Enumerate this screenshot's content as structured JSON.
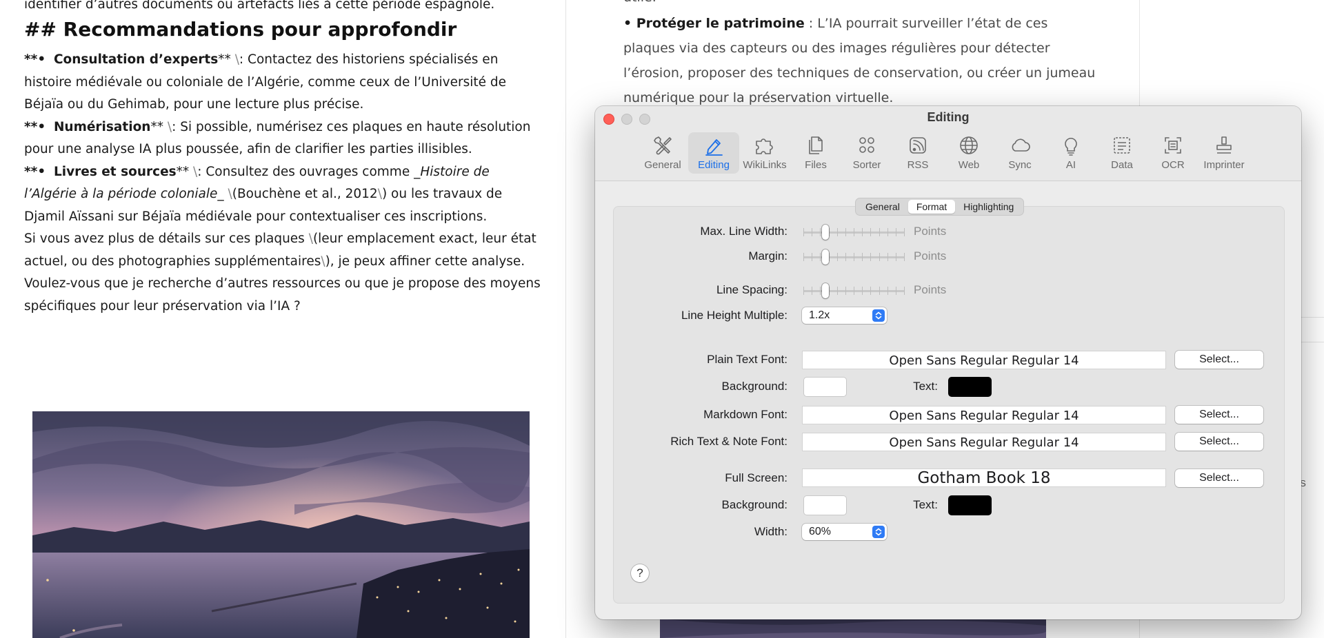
{
  "left_doc": {
    "top_line": "identifier d’autres documents ou artefacts liés à cette période espagnole.",
    "heading": "## Recommandations pour approfondir",
    "bullets": [
      {
        "prefix": "**•",
        "title": "Consultation d’experts",
        "suffix": "**",
        "sep": "\\",
        "text": ": Contactez des historiens spécialisés en histoire médiévale ou coloniale de l’Algérie, comme ceux de l’Université de Béjaïa ou du Gehimab, pour une lecture plus précise."
      },
      {
        "prefix": "**•",
        "title": "Numérisation",
        "suffix": "**",
        "sep": "\\",
        "text": ": Si possible, numérisez ces plaques en haute résolution pour une analyse IA plus poussée, afin de clarifier les parties illisibles."
      },
      {
        "prefix": "**•",
        "title": "Livres et sources",
        "suffix": "**",
        "sep": "\\",
        "text_a": ": Consultez des ouvrages comme ",
        "italic": "_Histoire de l’Algérie à la période coloniale_",
        "sep2": "\\",
        "text_b": "(Bouchène et al., 2012",
        "sep3": "\\",
        "text_c": ") ou les travaux de Djamil Aïssani sur Béjaïa médiévale pour contextualiser ces inscriptions."
      }
    ],
    "closing_a": "Si vous avez plus de détails sur ces plaques ",
    "closing_sep": "\\",
    "closing_b": "(leur emplacement exact, leur état actuel, ou des photographies supplémentaires",
    "closing_sep2": "\\",
    "closing_c": "), je peux affiner cette analyse. Voulez-vous que je recherche d’autres ressources ou que je propose des moyens spécifiques pour leur préservation via l’IA ?"
  },
  "right_doc": {
    "clipped": "utile.",
    "bullet_title": "• Protéger le patrimoine",
    "bullet_text": " : L’IA pourrait surveiller l’état de ces plaques via des capteurs ou des images régulières pour détecter l’érosion, proposer des techniques de conservation, ou créer un jumeau numérique pour la préservation virtuelle.",
    "sidebar_snippet": "on S"
  },
  "prefs": {
    "title": "Editing",
    "toolbar": [
      {
        "label": "General",
        "icon": "tools-icon"
      },
      {
        "label": "Editing",
        "icon": "pencil-icon"
      },
      {
        "label": "WikiLinks",
        "icon": "puzzle-icon"
      },
      {
        "label": "Files",
        "icon": "files-icon"
      },
      {
        "label": "Sorter",
        "icon": "sorter-icon"
      },
      {
        "label": "RSS",
        "icon": "rss-icon"
      },
      {
        "label": "Web",
        "icon": "globe-icon"
      },
      {
        "label": "Sync",
        "icon": "cloud-icon"
      },
      {
        "label": "AI",
        "icon": "lightbulb-icon"
      },
      {
        "label": "Data",
        "icon": "data-icon"
      },
      {
        "label": "OCR",
        "icon": "ocr-icon"
      },
      {
        "label": "Imprinter",
        "icon": "stamp-icon"
      }
    ],
    "selected_tab": "Editing",
    "subtabs": [
      "General",
      "Format",
      "Highlighting"
    ],
    "selected_subtab": "Format",
    "accent_color": "#1a6ee8",
    "labels": {
      "max_line_width": "Max. Line Width:",
      "margin": "Margin:",
      "line_spacing": "Line Spacing:",
      "line_height_multiple": "Line Height Multiple:",
      "plain_text_font": "Plain Text Font:",
      "background": "Background:",
      "text": "Text:",
      "markdown_font": "Markdown Font:",
      "rich_text_font": "Rich Text & Note Font:",
      "full_screen": "Full Screen:",
      "width": "Width:"
    },
    "units": {
      "points": "Points"
    },
    "slider_levels": {
      "max_line_width": 0.2,
      "margin": 0.2,
      "line_spacing": 0.2
    },
    "line_height_multiple": "1.2x",
    "width_value": "60%",
    "plain_text_font_value": "Open Sans Regular Regular 14",
    "markdown_font_value": "Open Sans Regular Regular 14",
    "rich_text_font_value": "Open Sans Regular Regular 14",
    "full_screen_font_value": "Gotham Book 18",
    "select_label": "Select...",
    "help_label": "?"
  }
}
